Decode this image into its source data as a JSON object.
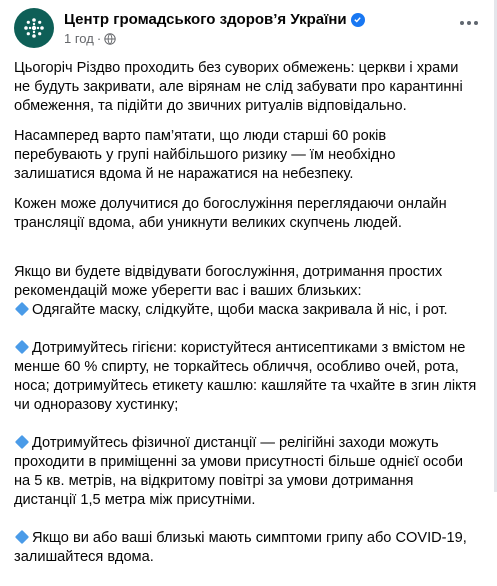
{
  "post": {
    "author": "Центр громадського здоров’я України",
    "time": "1 год",
    "separator": "·",
    "paragraphs": [
      "Цьогоріч Різдво проходить без суворих обмежень: церкви і храми\nне будуть закривати, але вірянам не слід забувати про карантинні\nобмеження, та підійти до звичних ритуалів відповідально.",
      "Насамперед варто пам’ятати, що люди старші 60 років\nперебувають у групі найбільшого ризику — їм необхідно\nзалишатися вдома й не наражатися на небезпеку.",
      "Кожен може долучитися до богослужіння переглядаючи онлайн\nтрансляції вдома, аби уникнути великих скупчень людей.",
      "Якщо ви будете відвідувати богослужіння, дотримання простих\nрекомендацій може уберегти вас і ваших близьких:"
    ],
    "bullets": [
      "Одягайте маску, слідкуйте, щоби маска закривала й ніс, і рот.",
      "Дотримуйтесь гігієни: користуйтеся антисептиками з вмістом не\nменше 60 % спирту, не торкайтесь обличчя, особливо очей, рота,\nноса; дотримуйтесь етикету кашлю: кашляйте та чхайте в згин ліктя\nчи одноразову хустинку;",
      "Дотримуйтесь фізичної дистанції — релігійні заходи можуть\nпроходити в приміщенні за умови присутності більше однієї особи\nна 5 кв. метрів, на відкритому повітрі за умови дотримання\nдистанції 1,5 метра між присутніми.",
      "Якщо ви або ваші близькі мають симптоми грипу або COVID-19,\nзалишайтеся вдома."
    ]
  },
  "colors": {
    "avatar_bg": "#0e5f57",
    "verified": "#1877f2",
    "bullet_diamond": "#4a9be8",
    "meta_text": "#65676b"
  },
  "icons": {
    "avatar": "organization-logo-icon",
    "verified": "verified-badge-icon",
    "privacy": "globe-icon",
    "menu": "more-options-icon",
    "bullet": "blue-diamond-icon"
  }
}
